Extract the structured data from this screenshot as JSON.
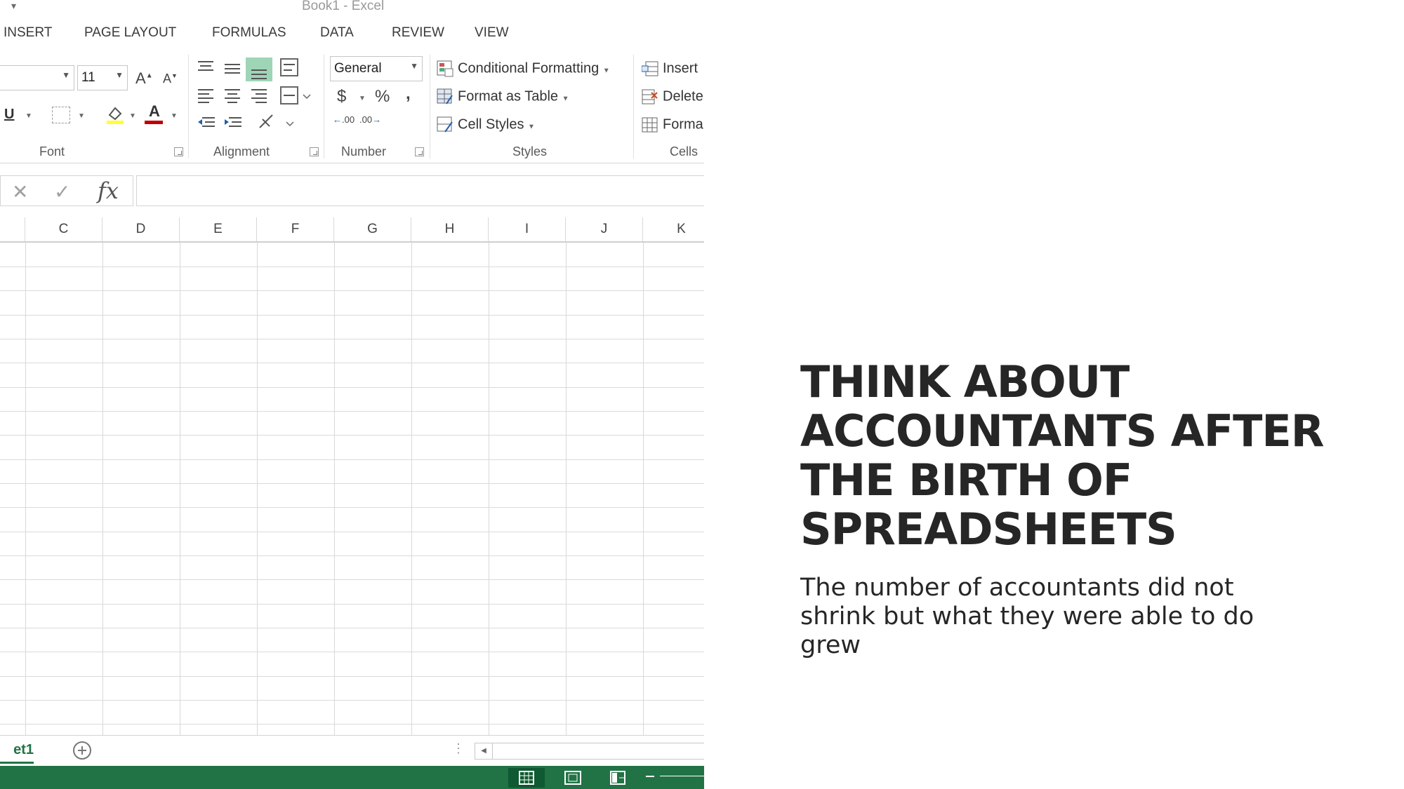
{
  "window": {
    "title": "Book1 - Excel",
    "qat_caret": "▾"
  },
  "ribbon_tabs": [
    "INSERT",
    "PAGE LAYOUT",
    "FORMULAS",
    "DATA",
    "REVIEW",
    "VIEW"
  ],
  "font_group": {
    "label": "Font",
    "font_size": "11",
    "grow_font": "A",
    "shrink_font": "A",
    "underline": "U",
    "font_color_glyph": "A"
  },
  "alignment_group": {
    "label": "Alignment"
  },
  "number_group": {
    "label": "Number",
    "format": "General",
    "currency": "$",
    "percent": "%",
    "comma": ",",
    "inc_decimal": ".00",
    "dec_decimal": ".00"
  },
  "styles_group": {
    "label": "Styles",
    "conditional_formatting": "Conditional Formatting",
    "format_as_table": "Format as Table",
    "cell_styles": "Cell Styles"
  },
  "cells_group": {
    "label": "Cells",
    "insert": "Insert",
    "delete": "Delete",
    "format": "Forma"
  },
  "formula_bar": {
    "cancel": "✕",
    "enter": "✓",
    "fx": "fx",
    "value": ""
  },
  "columns": [
    "C",
    "D",
    "E",
    "F",
    "G",
    "H",
    "I",
    "J",
    "K"
  ],
  "sheet": {
    "tab_label": "et1"
  },
  "colors": {
    "excel_green": "#217346",
    "highlight": "#9fd5b7",
    "headline": "#262626"
  },
  "slide": {
    "headline_lines": [
      "THINK ABOUT",
      "ACCOUNTANTS AFTER",
      "THE BIRTH OF",
      "SPREADSHEETS"
    ],
    "subtext_lines": [
      "The number of accountants did not",
      "shrink but what they were able to do",
      "grew"
    ]
  }
}
